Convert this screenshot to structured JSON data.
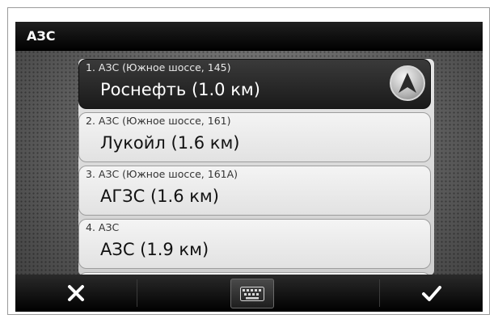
{
  "title": "АЗС",
  "items": [
    {
      "address": "1. АЗС (Южное шоссе, 145)",
      "name": "Роснефть (1.0 км)",
      "selected": true
    },
    {
      "address": "2. АЗС (Южное шоссе, 161)",
      "name": "Лукойл (1.6 км)",
      "selected": false
    },
    {
      "address": "3. АЗС (Южное шоссе, 161А)",
      "name": "АГЗС (1.6 км)",
      "selected": false
    },
    {
      "address": "4. АЗС",
      "name": "АЗС (1.9 км)",
      "selected": false
    }
  ],
  "buttons": {
    "cancel_icon": "close-icon",
    "keyboard_icon": "keyboard-icon",
    "confirm_icon": "check-icon",
    "navigate_icon": "navigate-arrow-icon"
  }
}
